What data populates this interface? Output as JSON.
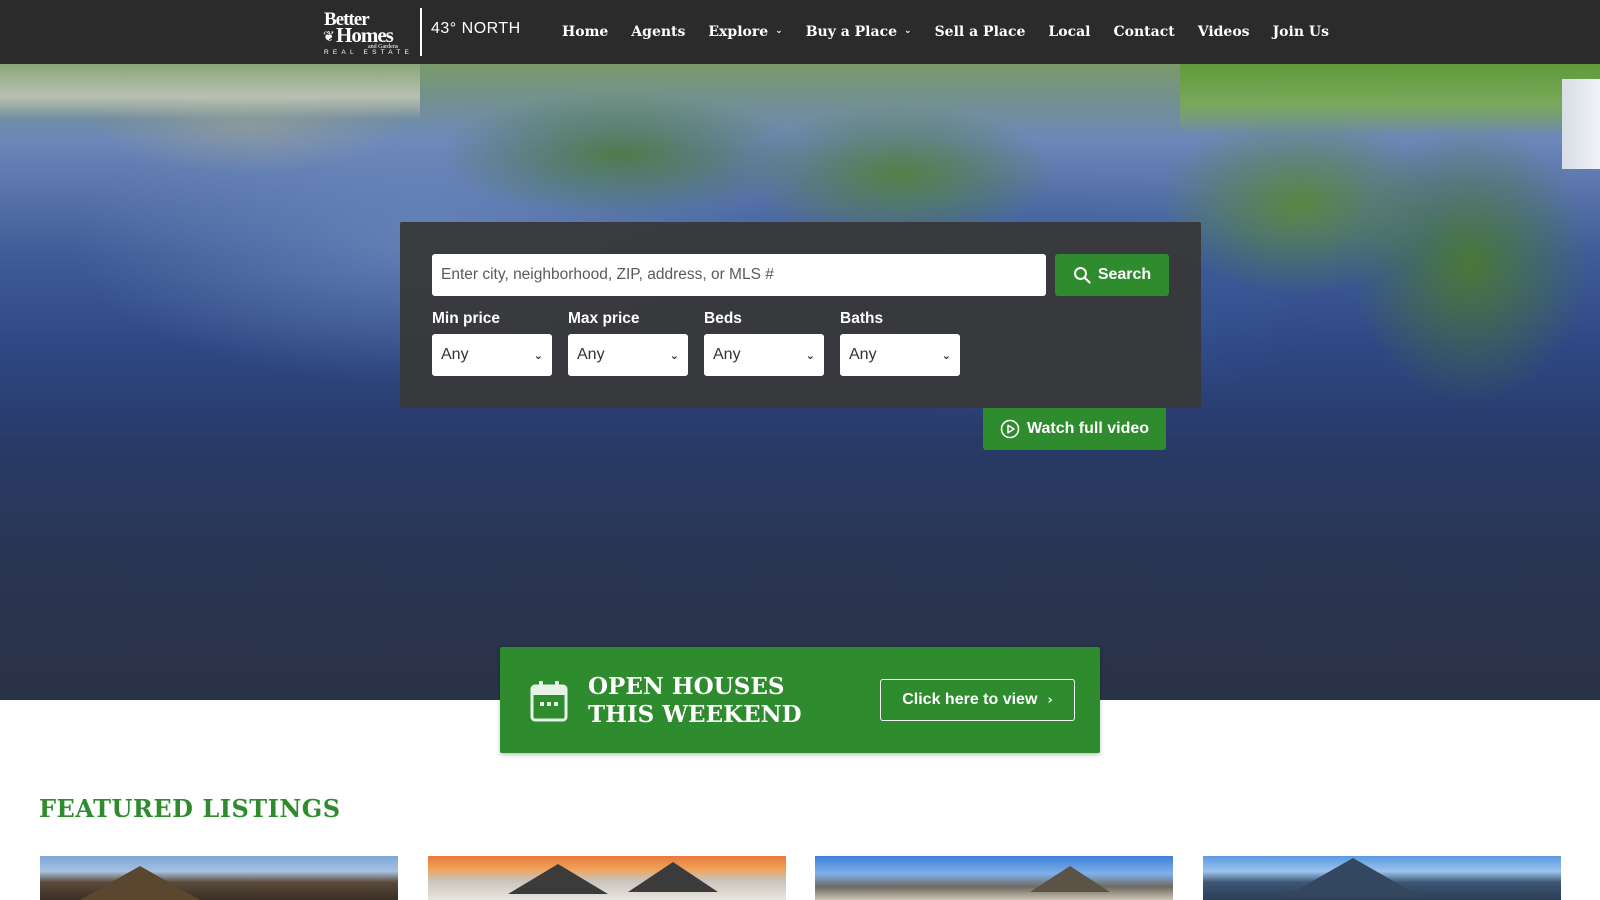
{
  "brand": {
    "logo_better": "Better",
    "logo_homes": "Homes",
    "logo_gardens": "and Gardens",
    "logo_re": "REAL ESTATE",
    "office": "43° NORTH"
  },
  "nav": {
    "items": [
      {
        "label": "Home",
        "dropdown": false
      },
      {
        "label": "Agents",
        "dropdown": false
      },
      {
        "label": "Explore",
        "dropdown": true
      },
      {
        "label": "Buy a Place",
        "dropdown": true
      },
      {
        "label": "Sell a Place",
        "dropdown": false
      },
      {
        "label": "Local",
        "dropdown": false
      },
      {
        "label": "Contact",
        "dropdown": false
      },
      {
        "label": "Videos",
        "dropdown": false
      },
      {
        "label": "Join Us",
        "dropdown": false
      }
    ]
  },
  "search": {
    "placeholder": "Enter city, neighborhood, ZIP, address, or MLS #",
    "value": "",
    "button_label": "Search",
    "button_icon": "search-icon",
    "filters": [
      {
        "label": "Min price",
        "value": "Any"
      },
      {
        "label": "Max price",
        "value": "Any"
      },
      {
        "label": "Beds",
        "value": "Any"
      },
      {
        "label": "Baths",
        "value": "Any"
      }
    ]
  },
  "video": {
    "label": "Watch full video",
    "icon": "play-circle-icon"
  },
  "open_houses": {
    "title_line1": "OPEN HOUSES",
    "title_line2": "THIS WEEKEND",
    "icon": "calendar-icon",
    "button_label": "Click here to view"
  },
  "featured": {
    "title": "FEATURED LISTINGS",
    "listings": [
      {
        "image": "listing-photo-1"
      },
      {
        "image": "listing-photo-2"
      },
      {
        "image": "listing-photo-3"
      },
      {
        "image": "listing-photo-4"
      }
    ]
  },
  "colors": {
    "nav_bg": "#2b2b2b",
    "accent_green": "#2e8b2e",
    "search_panel_bg": "#383838",
    "text_white": "#ffffff"
  }
}
